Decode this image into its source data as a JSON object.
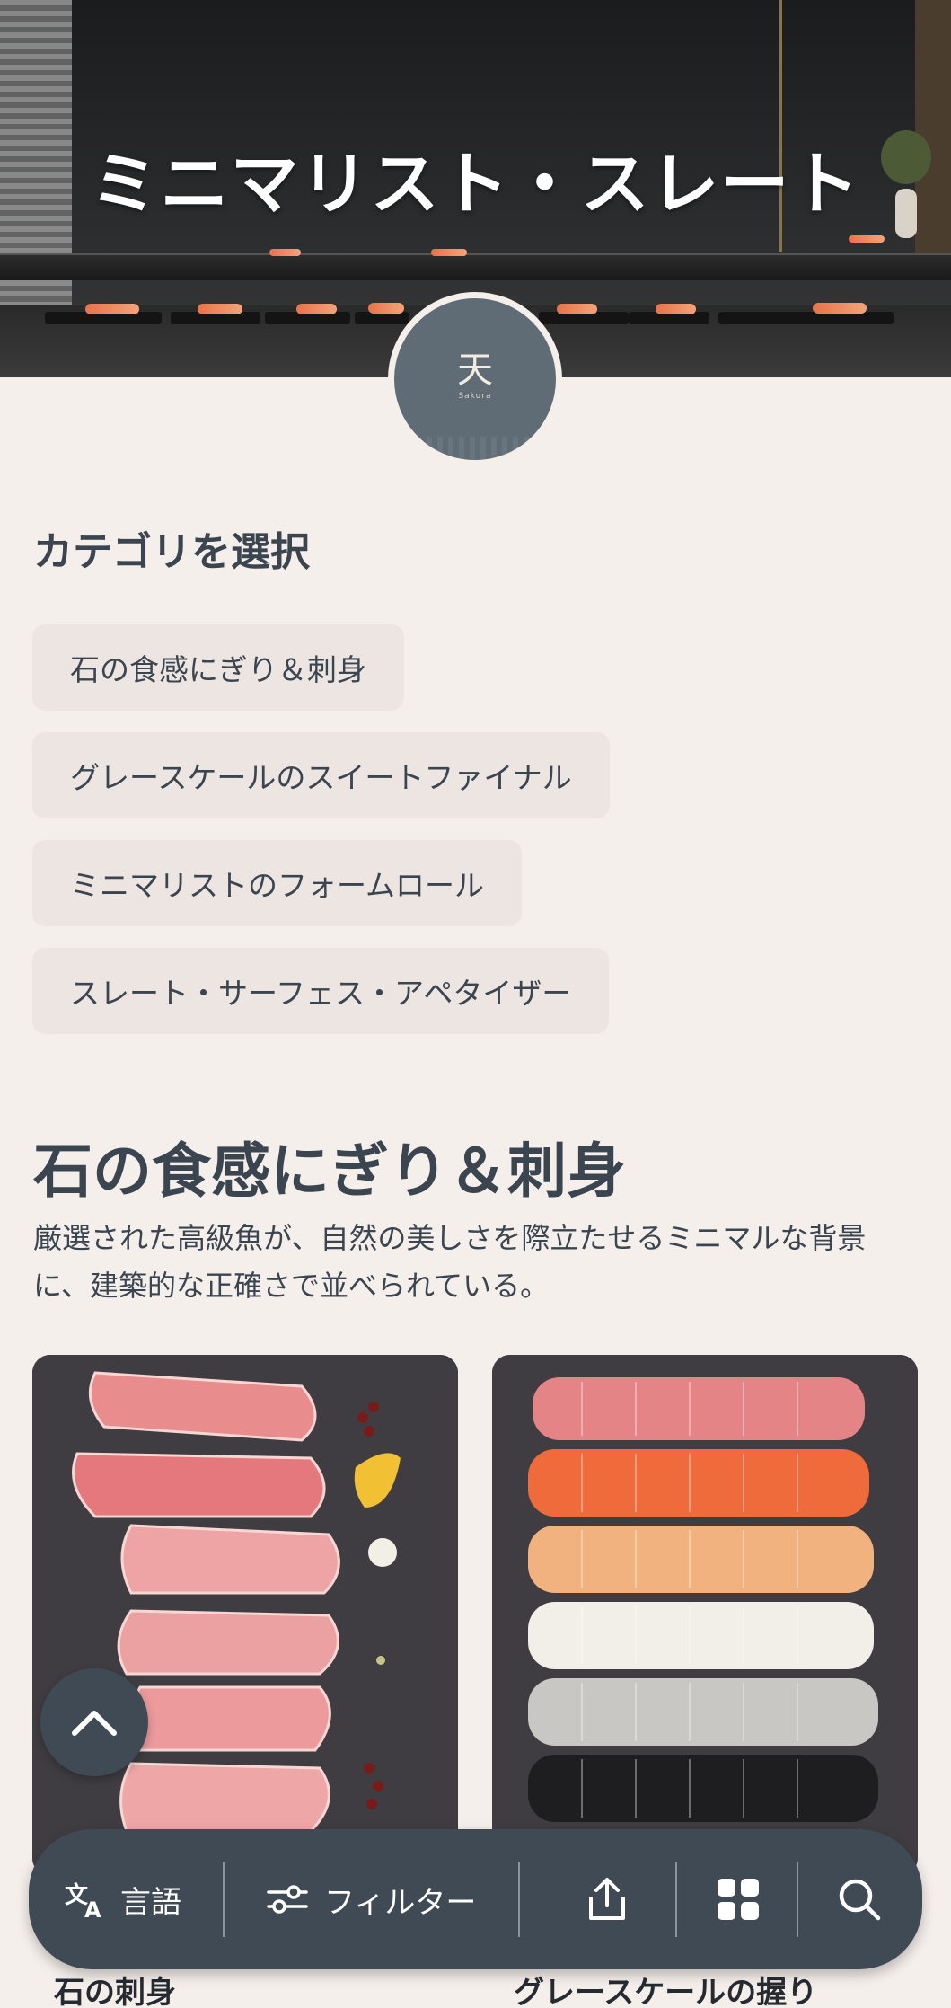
{
  "hero": {
    "title": "ミニマリスト・スレート"
  },
  "logo": {
    "mark": "天",
    "subtext": "Sakura"
  },
  "categories": {
    "heading": "カテゴリを選択",
    "items": [
      {
        "label": "石の食感にぎり＆刺身"
      },
      {
        "label": "グレースケールのスイートファイナル"
      },
      {
        "label": "ミニマリストのフォームロール"
      },
      {
        "label": "スレート・サーフェス・アペタイザー"
      }
    ]
  },
  "menu": {
    "title": "石の食感にぎり＆刺身",
    "description": "厳選された高級魚が、自然の美しさを際立たせるミニマルな背景に、建築的な正確さで並べられている。",
    "cards": [
      {
        "name": "石の刺身"
      },
      {
        "name": "グレースケールの握り"
      }
    ]
  },
  "bottom_bar": {
    "language_label": "言語",
    "filter_label": "フィルター",
    "icons": [
      "translate-icon",
      "filter-icon",
      "share-icon",
      "grid-icon",
      "search-icon"
    ]
  },
  "colors": {
    "background": "#f5efeb",
    "chip": "#ece5e1",
    "slate": "#3f4a55",
    "text": "#3b4550"
  }
}
